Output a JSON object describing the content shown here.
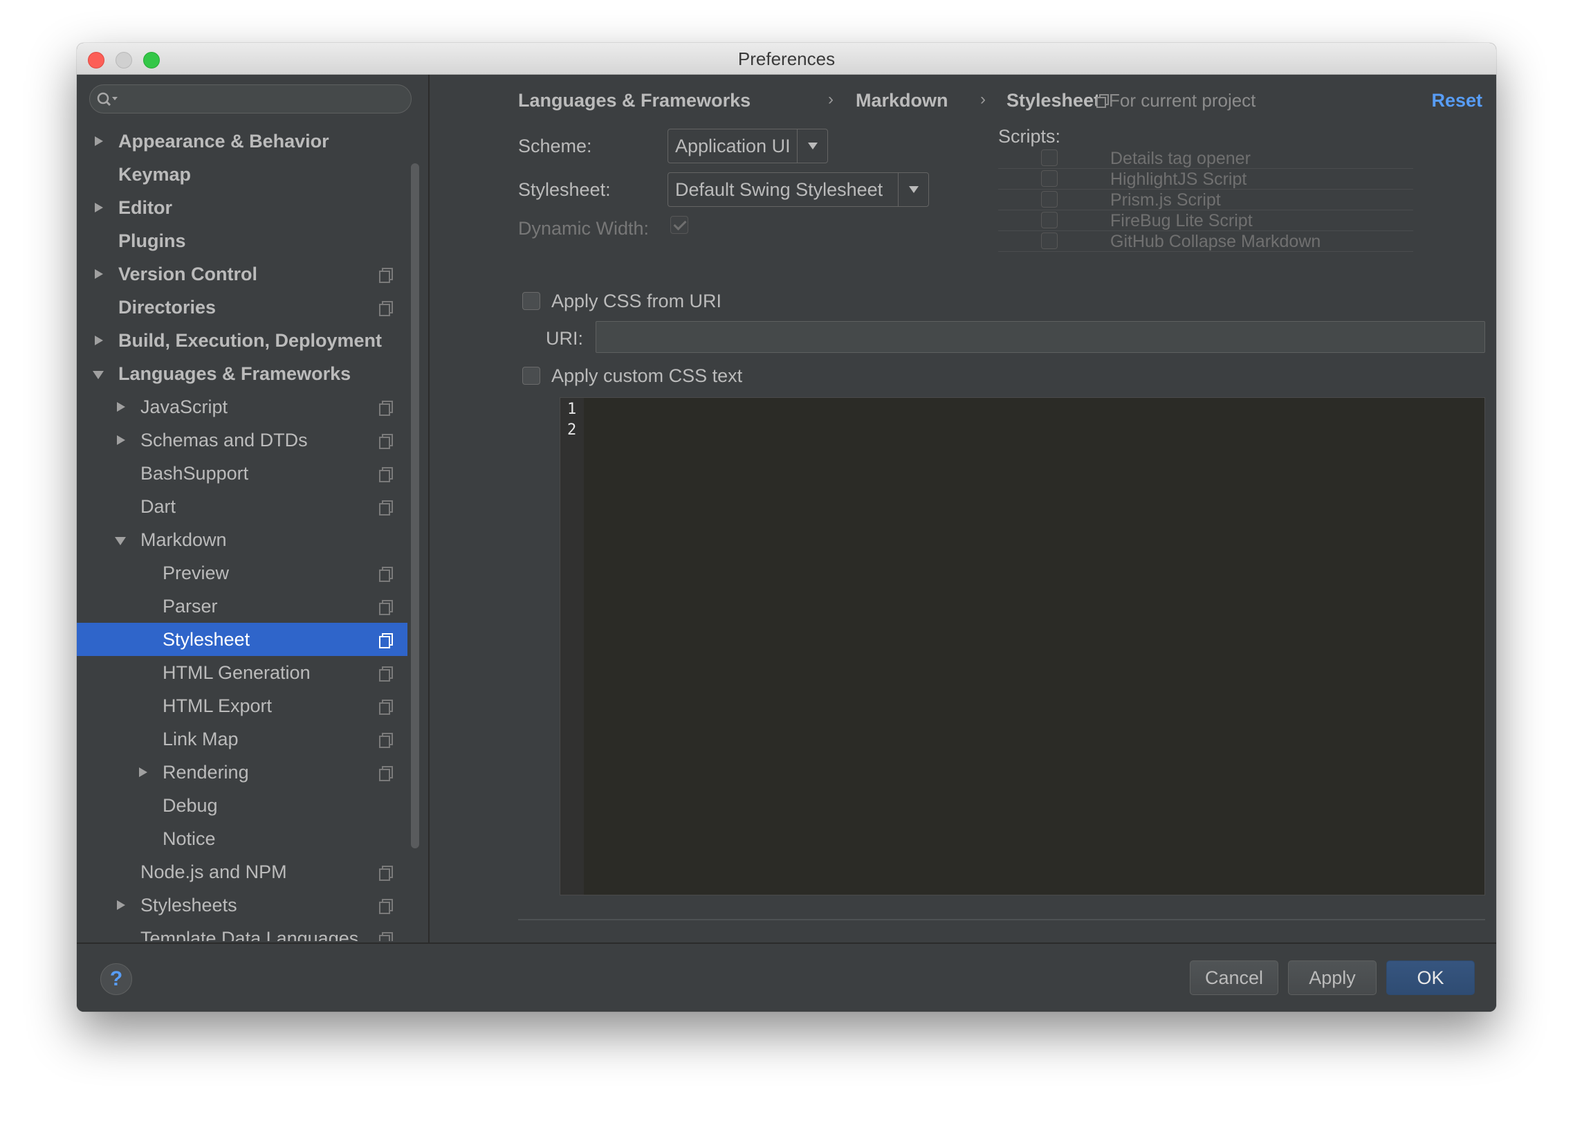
{
  "window": {
    "title": "Preferences"
  },
  "sidebar": {
    "search": {
      "placeholder": ""
    },
    "items": [
      {
        "label": "Appearance & Behavior",
        "level": 0,
        "bold": true,
        "expander": "collapsed",
        "project_icon": false
      },
      {
        "label": "Keymap",
        "level": 0,
        "bold": true,
        "expander": "none",
        "project_icon": false
      },
      {
        "label": "Editor",
        "level": 0,
        "bold": true,
        "expander": "collapsed",
        "project_icon": false
      },
      {
        "label": "Plugins",
        "level": 0,
        "bold": true,
        "expander": "none",
        "project_icon": false
      },
      {
        "label": "Version Control",
        "level": 0,
        "bold": true,
        "expander": "collapsed",
        "project_icon": true
      },
      {
        "label": "Directories",
        "level": 0,
        "bold": true,
        "expander": "none",
        "project_icon": true
      },
      {
        "label": "Build, Execution, Deployment",
        "level": 0,
        "bold": true,
        "expander": "collapsed",
        "project_icon": false
      },
      {
        "label": "Languages & Frameworks",
        "level": 0,
        "bold": true,
        "expander": "expanded",
        "project_icon": false
      },
      {
        "label": "JavaScript",
        "level": 1,
        "bold": false,
        "expander": "collapsed",
        "project_icon": true
      },
      {
        "label": "Schemas and DTDs",
        "level": 1,
        "bold": false,
        "expander": "collapsed",
        "project_icon": true
      },
      {
        "label": "BashSupport",
        "level": 1,
        "bold": false,
        "expander": "none",
        "project_icon": true
      },
      {
        "label": "Dart",
        "level": 1,
        "bold": false,
        "expander": "none",
        "project_icon": true
      },
      {
        "label": "Markdown",
        "level": 1,
        "bold": false,
        "expander": "expanded",
        "project_icon": false
      },
      {
        "label": "Preview",
        "level": 2,
        "bold": false,
        "expander": "none",
        "project_icon": true
      },
      {
        "label": "Parser",
        "level": 2,
        "bold": false,
        "expander": "none",
        "project_icon": true
      },
      {
        "label": "Stylesheet",
        "level": 2,
        "bold": false,
        "expander": "none",
        "project_icon": true,
        "selected": true
      },
      {
        "label": "HTML Generation",
        "level": 2,
        "bold": false,
        "expander": "none",
        "project_icon": true
      },
      {
        "label": "HTML Export",
        "level": 2,
        "bold": false,
        "expander": "none",
        "project_icon": true
      },
      {
        "label": "Link Map",
        "level": 2,
        "bold": false,
        "expander": "none",
        "project_icon": true
      },
      {
        "label": "Rendering",
        "level": 2,
        "bold": false,
        "expander": "collapsed",
        "project_icon": true
      },
      {
        "label": "Debug",
        "level": 2,
        "bold": false,
        "expander": "none",
        "project_icon": false
      },
      {
        "label": "Notice",
        "level": 2,
        "bold": false,
        "expander": "none",
        "project_icon": false
      },
      {
        "label": "Node.js and NPM",
        "level": 1,
        "bold": false,
        "expander": "none",
        "project_icon": true
      },
      {
        "label": "Stylesheets",
        "level": 1,
        "bold": false,
        "expander": "collapsed",
        "project_icon": true
      },
      {
        "label": "Template Data Languages",
        "level": 1,
        "bold": false,
        "expander": "none",
        "project_icon": true
      }
    ]
  },
  "breadcrumb": {
    "items": [
      "Languages & Frameworks",
      "Markdown",
      "Stylesheet"
    ],
    "separator": "›",
    "scope_label": "For current project",
    "reset_label": "Reset"
  },
  "settings": {
    "scheme_label": "Scheme:",
    "scheme_value": "Application UI",
    "stylesheet_label": "Stylesheet:",
    "stylesheet_value": "Default Swing Stylesheet",
    "dynamic_width_label": "Dynamic Width:",
    "dynamic_width_checked": true,
    "scripts_label": "Scripts:",
    "scripts": [
      {
        "label": "Details tag opener",
        "checked": false
      },
      {
        "label": "HighlightJS Script",
        "checked": false
      },
      {
        "label": "Prism.js Script",
        "checked": false
      },
      {
        "label": "FireBug Lite Script",
        "checked": false
      },
      {
        "label": "GitHub Collapse Markdown",
        "checked": false
      }
    ],
    "apply_css_uri_label": "Apply CSS from URI",
    "apply_css_uri_checked": false,
    "uri_label": "URI:",
    "uri_value": "",
    "apply_custom_css_label": "Apply custom CSS text",
    "apply_custom_css_checked": false,
    "editor_line_numbers": [
      "1",
      "2"
    ]
  },
  "footer": {
    "help_label": "?",
    "cancel_label": "Cancel",
    "apply_label": "Apply",
    "ok_label": "OK"
  },
  "colors": {
    "background": "#3c3f41",
    "selection": "#2f65ca",
    "link": "#589df6",
    "editor_background": "#2b2b26"
  }
}
